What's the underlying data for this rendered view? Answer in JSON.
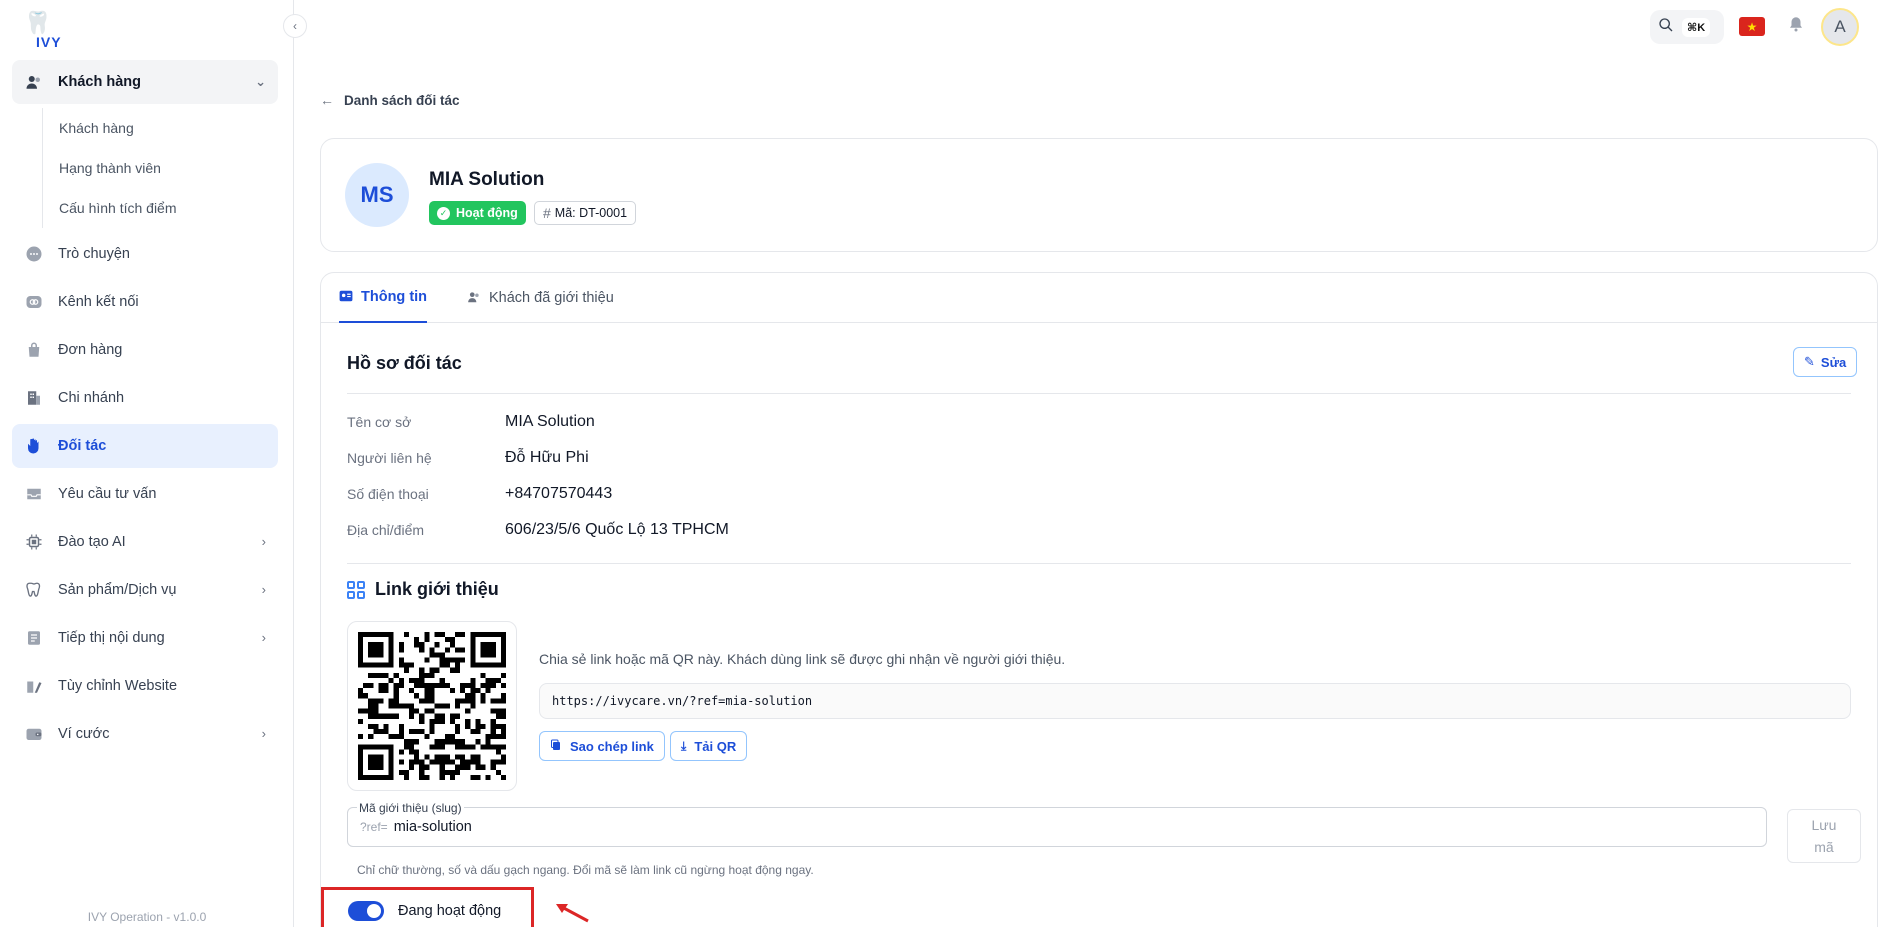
{
  "sidebar": {
    "logo_text": "IVY",
    "items": [
      {
        "label": "Khách hàng",
        "icon": "users-icon"
      },
      {
        "label": "Trò chuyện",
        "icon": "chat-icon"
      },
      {
        "label": "Kênh kết nối",
        "icon": "link-icon"
      },
      {
        "label": "Đơn hàng",
        "icon": "bag-icon"
      },
      {
        "label": "Chi nhánh",
        "icon": "building-icon"
      },
      {
        "label": "Đối tác",
        "icon": "handshake-icon"
      },
      {
        "label": "Yêu cầu tư vấn",
        "icon": "inbox-icon"
      },
      {
        "label": "Đào tạo AI",
        "icon": "chip-icon"
      },
      {
        "label": "Sản phẩm/Dịch vụ",
        "icon": "tooth-icon"
      },
      {
        "label": "Tiếp thị nội dung",
        "icon": "document-icon"
      },
      {
        "label": "Tùy chỉnh Website",
        "icon": "palette-icon"
      },
      {
        "label": "Ví cước",
        "icon": "wallet-icon"
      }
    ],
    "sub_items": [
      "Khách hàng",
      "Hạng thành viên",
      "Cấu hình tích điểm"
    ],
    "version": "IVY Operation - v1.0.0"
  },
  "topbar": {
    "shortcut": "⌘K",
    "avatar_initial": "A"
  },
  "breadcrumb": {
    "back_label": "Danh sách đối tác"
  },
  "partner": {
    "initials": "MS",
    "name": "MIA Solution",
    "status": "Hoạt động",
    "code": "Mã: DT-0001"
  },
  "tabs": [
    "Thông tin",
    "Khách đã giới thiệu"
  ],
  "profile": {
    "title": "Hồ sơ đối tác",
    "edit_label": "Sửa",
    "rows": [
      {
        "label": "Tên cơ sở",
        "value": "MIA Solution"
      },
      {
        "label": "Người liên hệ",
        "value": "Đỗ Hữu Phi"
      },
      {
        "label": "Số điện thoại",
        "value": "+84707570443"
      },
      {
        "label": "Địa chỉ/điểm",
        "value": "606/23/5/6 Quốc Lộ 13 TPHCM"
      }
    ]
  },
  "referral": {
    "title": "Link giới thiệu",
    "description": "Chia sẻ link hoặc mã QR này. Khách dùng link sẽ được ghi nhận về người giới thiệu.",
    "url": "https://ivycare.vn/?ref=mia-solution",
    "copy_label": "Sao chép link",
    "download_label": "Tải QR",
    "slug_label": "Mã giới thiệu (slug)",
    "slug_prefix": "?ref=",
    "slug_value": "mia-solution",
    "save_label_1": "Lưu",
    "save_label_2": "mã",
    "hint": "Chỉ chữ thường, số và dấu gạch ngang. Đổi mã sẽ làm link cũ ngừng hoạt động ngay."
  },
  "status_toggle": {
    "label": "Đang hoạt động",
    "on": true
  },
  "colors": {
    "accent": "#1d4ed8",
    "success": "#22c55e",
    "highlight": "#dc2626"
  }
}
